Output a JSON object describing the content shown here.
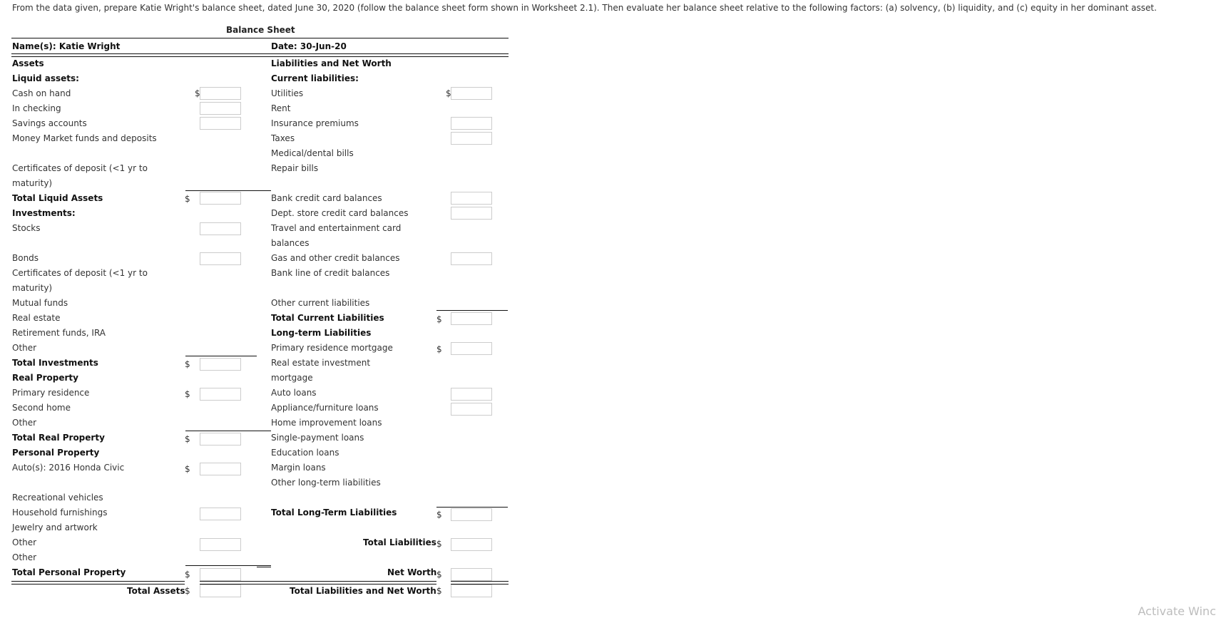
{
  "instruction": "From the data given, prepare Katie Wright's balance sheet, dated June 30, 2020 (follow the balance sheet form shown in Worksheet 2.1). Then evaluate her balance sheet relative to the following factors: (a) solvency, (b) liquidity, and (c) equity in her dominant asset.",
  "sheet": {
    "title": "Balance Sheet",
    "name_label": "Name(s): Katie Wright",
    "date_label": "Date: 30-Jun-20",
    "assets_header": "Assets",
    "liabilities_header": "Liabilities and Net Worth"
  },
  "assets": {
    "liquid_header": "Liquid assets:",
    "cash_on_hand": "Cash on hand",
    "in_checking": "In checking",
    "savings": "Savings accounts",
    "money_market": "Money Market funds and deposits",
    "cd_line1": "Certificates of deposit (<1 yr to",
    "cd_line2": "maturity)",
    "total_liquid": "Total Liquid Assets",
    "investments_header": "Investments:",
    "stocks": "Stocks",
    "bonds": "Bonds",
    "inv_cd_line1": "Certificates of deposit (<1 yr to",
    "inv_cd_line2": "maturity)",
    "mutual_funds": "Mutual funds",
    "real_estate": "Real estate",
    "retirement": "Retirement funds, IRA",
    "inv_other": "Other",
    "total_investments": "Total Investments",
    "real_property_header": "Real Property",
    "primary_residence": "Primary residence",
    "second_home": "Second home",
    "rp_other": "Other",
    "total_real_property": "Total Real Property",
    "personal_property_header": "Personal Property",
    "autos": "Auto(s): 2016 Honda Civic",
    "rv": "Recreational vehicles",
    "household": "Household furnishings",
    "jewelry": "Jewelry and artwork",
    "pp_other1": "Other",
    "pp_other2": "Other",
    "total_personal_property": "Total Personal Property",
    "total_assets": "Total Assets"
  },
  "liabilities": {
    "current_header": "Current liabilities:",
    "utilities": "Utilities",
    "rent": "Rent",
    "insurance": "Insurance premiums",
    "taxes": "Taxes",
    "medical": "Medical/dental bills",
    "repair": "Repair bills",
    "bank_cc": "Bank credit card balances",
    "dept_cc": "Dept. store credit card balances",
    "travel_line1": "Travel and entertainment card",
    "travel_line2": "balances",
    "gas": "Gas and other credit balances",
    "bank_loc": "Bank line of credit balances",
    "other_current": "Other current liabilities",
    "total_current": "Total Current Liabilities",
    "longterm_header": "Long-term Liabilities",
    "primary_mortgage": "Primary residence mortgage",
    "re_mortgage_line1": "Real estate investment",
    "re_mortgage_line2": "mortgage",
    "auto_loans": "Auto loans",
    "appliance": "Appliance/furniture loans",
    "home_improvement": "Home improvement loans",
    "single_payment": "Single-payment loans",
    "education": "Education loans",
    "margin": "Margin loans",
    "other_longterm": "Other long-term liabilities",
    "total_longterm": "Total Long-Term Liabilities",
    "total_liabilities": "Total Liabilities",
    "net_worth": "Net Worth",
    "total_liab_nw": "Total Liabilities and Net Worth"
  },
  "currency_symbol": "$",
  "inputs": {
    "cash_on_hand": "",
    "in_checking": "",
    "savings": "",
    "total_liquid": "",
    "stocks": "",
    "bonds": "",
    "total_investments": "",
    "primary_residence": "",
    "total_real_property": "",
    "autos": "",
    "household": "",
    "pp_other": "",
    "total_personal_property": "",
    "total_assets": "",
    "utilities": "",
    "insurance": "",
    "taxes": "",
    "bank_cc": "",
    "dept_cc": "",
    "gas": "",
    "total_current": "",
    "primary_mortgage": "",
    "auto_loans": "",
    "appliance": "",
    "total_longterm": "",
    "total_liabilities": "",
    "net_worth": "",
    "total_liab_nw": ""
  },
  "watermark": "Activate Winc"
}
